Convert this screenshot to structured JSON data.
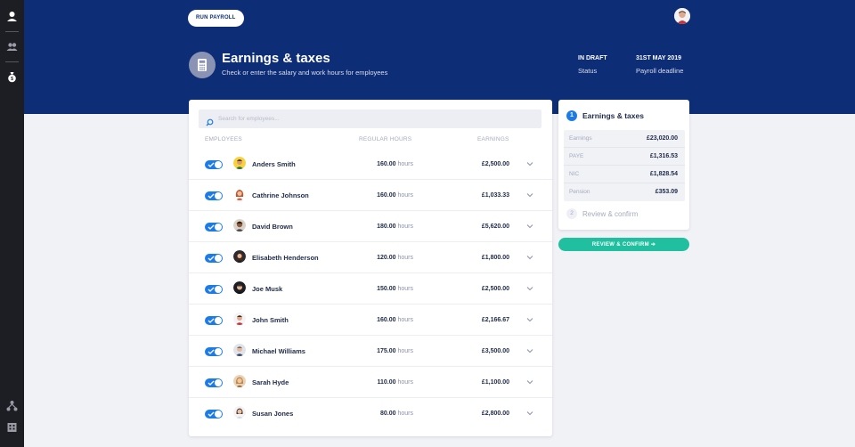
{
  "toolbar": {
    "run_payroll_label": "RUN PAYROLL"
  },
  "header": {
    "title": "Earnings & taxes",
    "subtitle": "Check or enter the salary and work hours for employees",
    "status_value": "IN DRAFT",
    "status_label": "Status",
    "deadline_value": "31ST MAY 2019",
    "deadline_label": "Payroll deadline"
  },
  "search": {
    "placeholder": "Search for employees..."
  },
  "table": {
    "columns": [
      "EMPLOYEES",
      "REGULAR HOURS",
      "EARNINGS"
    ],
    "hours_unit": "hours",
    "rows": [
      {
        "name": "Anders Smith",
        "hours": "160.00",
        "earnings": "£2,500.00",
        "included": true
      },
      {
        "name": "Cathrine Johnson",
        "hours": "160.00",
        "earnings": "£1,033.33",
        "included": true
      },
      {
        "name": "David Brown",
        "hours": "180.00",
        "earnings": "£5,620.00",
        "included": true
      },
      {
        "name": "Elisabeth Henderson",
        "hours": "120.00",
        "earnings": "£1,800.00",
        "included": true
      },
      {
        "name": "Joe Musk",
        "hours": "150.00",
        "earnings": "£2,500.00",
        "included": true
      },
      {
        "name": "John Smith",
        "hours": "160.00",
        "earnings": "£2,166.67",
        "included": true
      },
      {
        "name": "Michael Williams",
        "hours": "175.00",
        "earnings": "£3,500.00",
        "included": true
      },
      {
        "name": "Sarah Hyde",
        "hours": "110.00",
        "earnings": "£1,100.00",
        "included": true
      },
      {
        "name": "Susan Jones",
        "hours": "80.00",
        "earnings": "£2,800.00",
        "included": true
      }
    ]
  },
  "summary": {
    "step1_number": "1",
    "step1_label": "Earnings & taxes",
    "items": [
      {
        "label": "Earnings",
        "value": "£23,020.00"
      },
      {
        "label": "PAYE",
        "value": "£1,316.53"
      },
      {
        "label": "NIC",
        "value": "£1,828.54"
      },
      {
        "label": "Pension",
        "value": "£353.09"
      }
    ],
    "step2_number": "2",
    "step2_label": "Review & confirm",
    "review_button": "REVIEW & CONFIRM ➔"
  },
  "colors": {
    "header_bg": "#0d2d76",
    "rail_bg": "#1d1d24",
    "toggle_on": "#1d7be5",
    "review_btn": "#1fbf9f"
  },
  "icons": [
    "user-icon",
    "team-icon",
    "money-bag-icon",
    "org-chart-icon",
    "building-icon",
    "calculator-icon",
    "search-icon",
    "chevron-down-icon",
    "check-icon"
  ]
}
